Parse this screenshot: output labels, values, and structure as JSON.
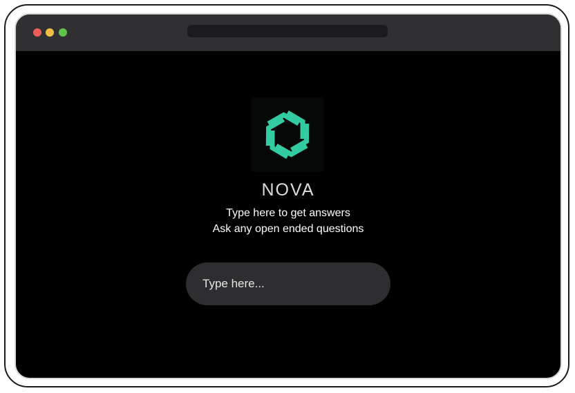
{
  "window": {
    "controls": {
      "close_color": "#ec5f58",
      "minimize_color": "#f4bd45",
      "maximize_color": "#5fc44c"
    },
    "address_bar": {
      "value": ""
    }
  },
  "brand": {
    "logo_icon": "nova-knot-icon",
    "logo_color": "#33cca0",
    "name": "NOVA"
  },
  "hero": {
    "line1": "Type here to get answers",
    "line2": "Ask any open ended questions"
  },
  "input": {
    "placeholder": "Type here...",
    "value": ""
  }
}
